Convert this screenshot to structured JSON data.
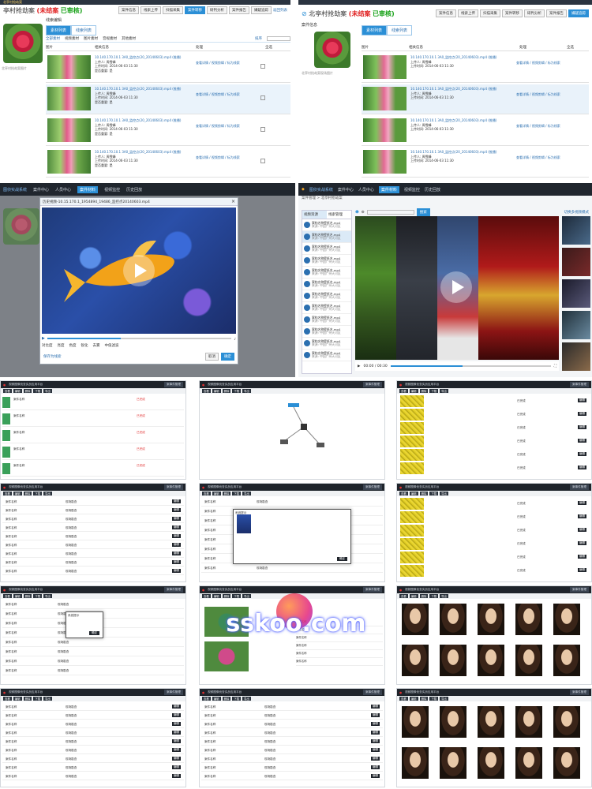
{
  "panels": {
    "tl": {
      "case_title": "亭村抢劫案",
      "status_unclosed": "(未结案",
      "status_reviewed": "已审核)",
      "breadcrumb": "北亭村抢劫案",
      "toolbar": [
        "案件信息",
        "线索上传",
        "扫描采集",
        "案件转移",
        "研判分析",
        "案件报告",
        "嫌疑追踪",
        "返回列表"
      ],
      "left_caption": "北亭村抢劫案图片",
      "section_label": "线索编辑",
      "tabs": [
        "素材列表",
        "线索列表"
      ],
      "filters": [
        "全部素材",
        "视频素材",
        "图片素材",
        "音视素材",
        "其他素材"
      ],
      "sort_label": "排序",
      "columns": [
        "图片",
        "相关信息",
        "处理"
      ],
      "select_all": "全选",
      "rows": [
        {
          "file": "10.140.170.10.1 3A0_监控点(20_20140603).mp4 (推播)",
          "uploader": "上传人: 周雪峰",
          "time": "上传时间: 2014-06-03 11:30",
          "tag": "是否重要: 是",
          "actions": "查看详情 / 视频剪辑 / 标为线索"
        },
        {
          "file": "10.140.170.10.1 3A0_监控点(20_20140603).mp4 (推播)",
          "uploader": "上传人: 周雪峰",
          "time": "上传时间: 2014-06-03 11:30",
          "tag": "是否重要: 是",
          "actions": "查看详情 / 视频剪辑 / 标为线索"
        },
        {
          "file": "10.140.170.10.1 3A0_监控点(20_20140603).mp4 (推播)",
          "uploader": "上传人: 周雪峰",
          "time": "上传时间: 2014-06-03 11:30",
          "tag": "是否重要: 是",
          "actions": "查看详情 / 视频剪辑 / 标为线索"
        },
        {
          "file": "10.140.170.10.1 3A0_监控点(20_20140603).mp4 (推播)",
          "uploader": "上传人: 周雪峰",
          "time": "上传时间: 2014-06-03 11:30",
          "tag": "是否重要: 是",
          "actions": "查看详情 / 视频剪辑 / 标为线索"
        }
      ]
    },
    "tr": {
      "case_title": "北亭村抢劫案",
      "status_unclosed": "(未结案",
      "status_reviewed": "已审核)",
      "section_label": "案件信息",
      "left_caption": "北亭村抢劫案现场图片"
    },
    "ml": {
      "app_title": "图侦实战系统",
      "nav": [
        "案件中心",
        "人员中心",
        "案件材料",
        "视频监控",
        "历史回放"
      ],
      "dialog_title": "历史视频-10.15.170.1.18",
      "dialog_file": "历史视频-10.15.170.1_1954894_19486_监控点20140603.mp4",
      "controls": [
        "对比度",
        "亮度",
        "色度",
        "锐化",
        "去雾",
        "中值滤波"
      ],
      "buttons": {
        "cancel": "取消",
        "ok": "确定"
      },
      "link": "保存为线索"
    },
    "mr": {
      "app_title": "图侦实战系统",
      "nav": [
        "案件中心",
        "人员中心",
        "案件材料",
        "视频监控",
        "历史回放"
      ],
      "breadcrumb": "案件管理 > 北亭村抢劫案",
      "list_tabs": [
        "视频资源",
        "线索管理"
      ],
      "list_items": [
        "案构名称壁纸名.mp4",
        "案构名称壁纸名.mp4",
        "案构名称壁纸名.mp4",
        "案构名称壁纸名.mp4",
        "案构名称壁纸名.mp4",
        "案构名称壁纸名.mp4",
        "案构名称壁纸名.mp4",
        "案构名称壁纸名.mp4",
        "案构名称壁纸名.mp4",
        "案构名称壁纸名.mp4",
        "案构名称壁纸名.mp4",
        "案构名称壁纸名.mp4"
      ],
      "list_sub": "来源: 中国广州天河区",
      "search_btn": "搜索",
      "timecode": "00:00 / 00:30",
      "mode_label": "切换多视频模式"
    },
    "bottom": {
      "app_title": "视频图像侦查实战应用平台",
      "tab_active": "案事件管理",
      "buttons": [
        "查看",
        "编辑",
        "删除",
        "下载",
        "导出"
      ],
      "table_cols": [
        "序号",
        "案件名称",
        "发生时间",
        "地点",
        "状态",
        "操作"
      ],
      "cell": "案件名称",
      "cell_alt": "现场勘查",
      "status": "已完成",
      "edit_link": "编辑",
      "dialog_title": "系统提示",
      "dialog_ok": "确定"
    },
    "watermark": "sskoo.com"
  }
}
